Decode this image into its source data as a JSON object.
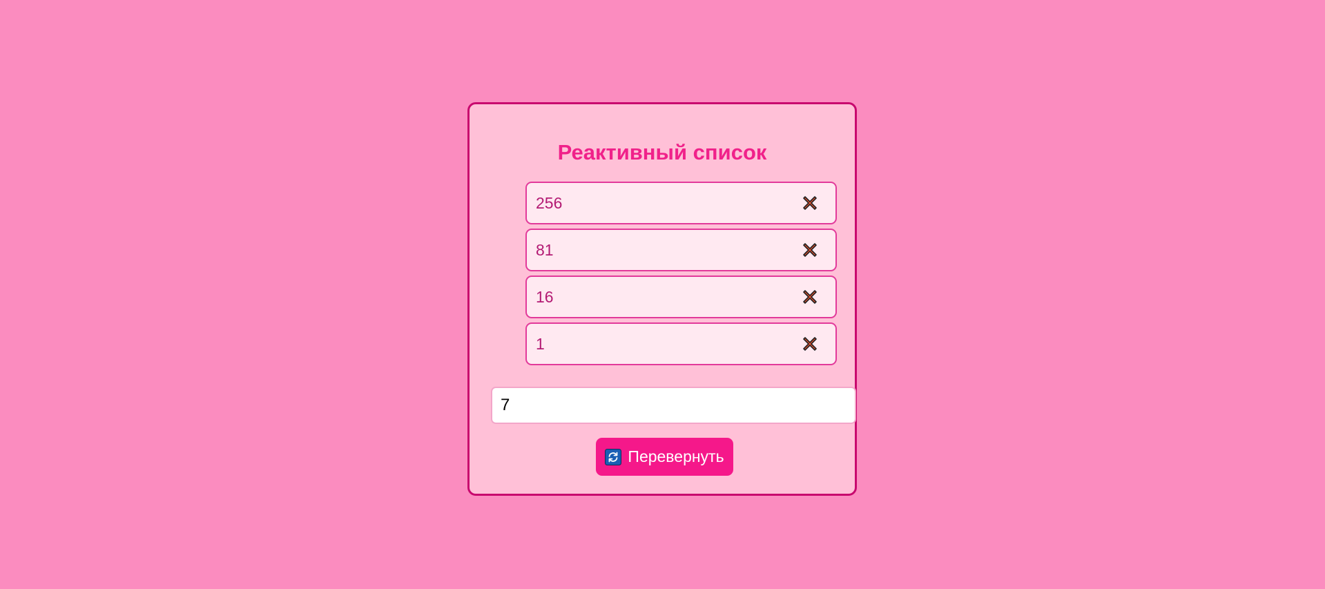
{
  "app": {
    "title": "Реактивный список"
  },
  "list": {
    "items": [
      {
        "value": "256"
      },
      {
        "value": "81"
      },
      {
        "value": "16"
      },
      {
        "value": "1"
      }
    ],
    "delete_icon": "cross-mark-icon"
  },
  "input": {
    "value": "7"
  },
  "actions": {
    "reverse_label": "Перевернуть",
    "reverse_icon": "refresh-icon"
  },
  "colors": {
    "background": "#fb8cbf",
    "card": "#ffc0d7",
    "card_border": "#c8086e",
    "title": "#f0218a",
    "item_background": "#ffe9f1",
    "item_border": "#e2399a",
    "item_text": "#b31a73",
    "button": "#f5188a",
    "delete_icon": "#e8502e"
  }
}
